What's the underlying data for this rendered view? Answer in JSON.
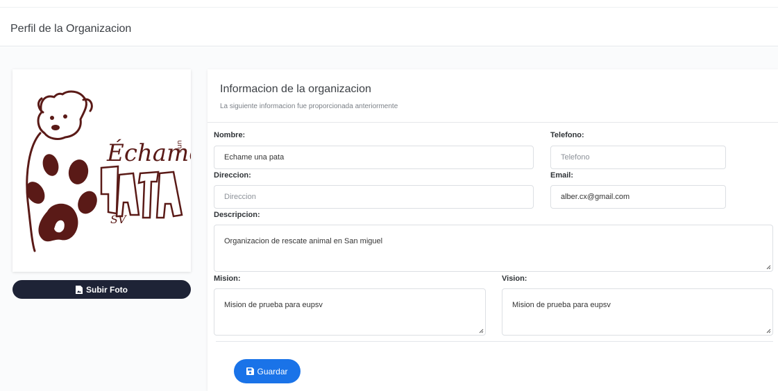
{
  "header": {
    "title": "Perfil de la Organizacion"
  },
  "photo": {
    "upload_label": "Subir Foto",
    "logo_text": {
      "main": "Échame",
      "vertical": "una",
      "big": "PATA",
      "suffix": "SV"
    },
    "logo_color": "#5a1a17"
  },
  "info": {
    "title": "Informacion de la organizacion",
    "subtitle": "La siguiente informacion fue proporcionada anteriormente"
  },
  "form": {
    "nombre": {
      "label": "Nombre:",
      "value": "Echame una pata"
    },
    "telefono": {
      "label": "Telefono:",
      "placeholder": "Telefono"
    },
    "direccion": {
      "label": "Direccion:",
      "placeholder": "Direccion"
    },
    "email": {
      "label": "Email:",
      "value": "alber.cx@gmail.com"
    },
    "descripcion": {
      "label": "Descripcion:",
      "value": "Organizacion de rescate animal en San miguel"
    },
    "mision": {
      "label": "Mision:",
      "value": "Mision de prueba para eupsv"
    },
    "vision": {
      "label": "Vision:",
      "value": "Mision de prueba para eupsv"
    }
  },
  "actions": {
    "save_label": "Guardar"
  },
  "colors": {
    "save_button": "#1a73e8",
    "upload_button": "#1e2336"
  }
}
